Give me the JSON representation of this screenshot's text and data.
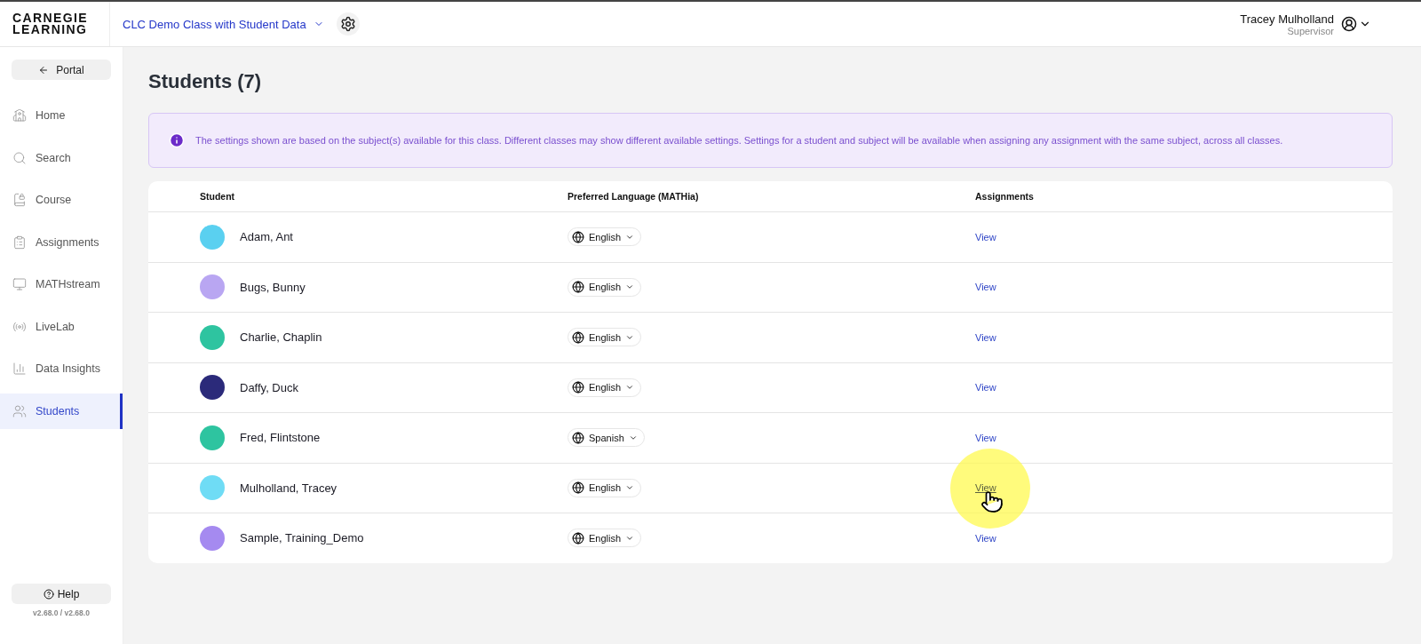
{
  "header": {
    "logo_line_1": "CARNEGIE",
    "logo_line_2": "LEARNING",
    "class_name": "CLC Demo Class with Student Data",
    "user_name": "Tracey Mulholland",
    "user_role": "Supervisor"
  },
  "sidebar": {
    "portal": "Portal",
    "items": [
      {
        "label": "Home",
        "selected": false
      },
      {
        "label": "Search",
        "selected": false
      },
      {
        "label": "Course",
        "selected": false
      },
      {
        "label": "Assignments",
        "selected": false
      },
      {
        "label": "MATHstream",
        "selected": false
      },
      {
        "label": "LiveLab",
        "selected": false
      },
      {
        "label": "Data Insights",
        "selected": false
      },
      {
        "label": "Students",
        "selected": true
      }
    ],
    "help": "Help",
    "version": "v2.68.0 / v2.68.0"
  },
  "page": {
    "title": "Students (7)",
    "notice": "The settings shown are based on the subject(s) available for this class. Different classes may show different available settings. Settings for a student and subject will be available when assigning any assignment with the same subject, across all classes."
  },
  "table": {
    "columns": [
      "Student",
      "Preferred Language (MATHia)",
      "Assignments"
    ],
    "rows": [
      {
        "name": "Adam, Ant",
        "color": "#5ad0f0",
        "language": "English",
        "action": "View",
        "hovered": false
      },
      {
        "name": "Bugs, Bunny",
        "color": "#b9a6f2",
        "language": "English",
        "action": "View",
        "hovered": false
      },
      {
        "name": "Charlie, Chaplin",
        "color": "#2ec4a0",
        "language": "English",
        "action": "View",
        "hovered": false
      },
      {
        "name": "Daffy, Duck",
        "color": "#2b2a7a",
        "language": "English",
        "action": "View",
        "hovered": false
      },
      {
        "name": "Fred, Flintstone",
        "color": "#2ec4a0",
        "language": "Spanish",
        "action": "View",
        "hovered": false
      },
      {
        "name": "Mulholland, Tracey",
        "color": "#6fdcf5",
        "language": "English",
        "action": "View",
        "hovered": true
      },
      {
        "name": "Sample, Training_Demo",
        "color": "#a58af0",
        "language": "English",
        "action": "View",
        "hovered": false
      }
    ]
  }
}
